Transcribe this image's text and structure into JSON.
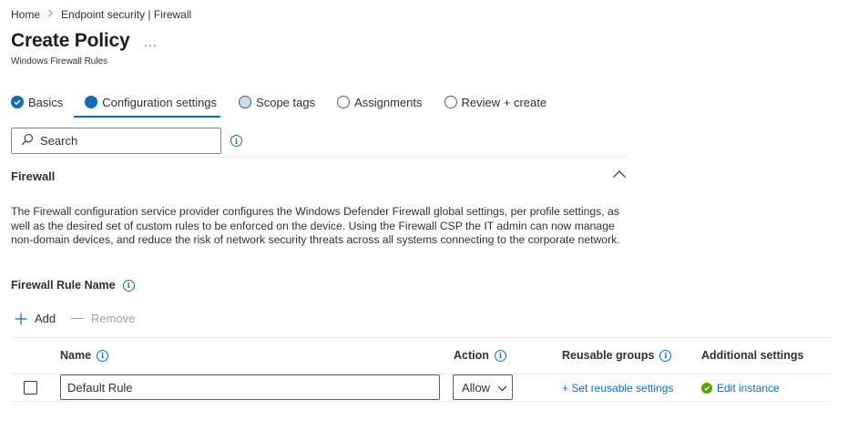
{
  "breadcrumb": {
    "home": "Home",
    "current": "Endpoint security | Firewall"
  },
  "header": {
    "title": "Create Policy",
    "more": "...",
    "subtitle": "Windows Firewall Rules"
  },
  "tabs": [
    {
      "label": "Basics",
      "state": "done"
    },
    {
      "label": "Configuration settings",
      "state": "active"
    },
    {
      "label": "Scope tags",
      "state": "partial"
    },
    {
      "label": "Assignments",
      "state": "empty"
    },
    {
      "label": "Review + create",
      "state": "empty"
    }
  ],
  "search": {
    "placeholder": "Search",
    "value": ""
  },
  "section": {
    "title": "Firewall",
    "description": "The Firewall configuration service provider configures the Windows Defender Firewall global settings, per profile settings, as well as the desired set of custom rules to be enforced on the device. Using the Firewall CSP the IT admin can now manage non-domain devices, and reduce the risk of network security threats across all systems connecting to the corporate network."
  },
  "rule_field": {
    "label": "Firewall Rule Name",
    "add_label": "Add",
    "remove_label": "Remove"
  },
  "table": {
    "columns": {
      "name": "Name",
      "action": "Action",
      "reusable": "Reusable groups",
      "additional": "Additional settings"
    },
    "rows": [
      {
        "name": "Default Rule",
        "action": "Allow",
        "reusable_link": "+ Set reusable settings",
        "additional_link": "Edit instance",
        "checked": false
      }
    ]
  },
  "colors": {
    "accent": "#0f6cbd",
    "success": "#57a300",
    "text": "#323130",
    "border": "#8a8886"
  }
}
